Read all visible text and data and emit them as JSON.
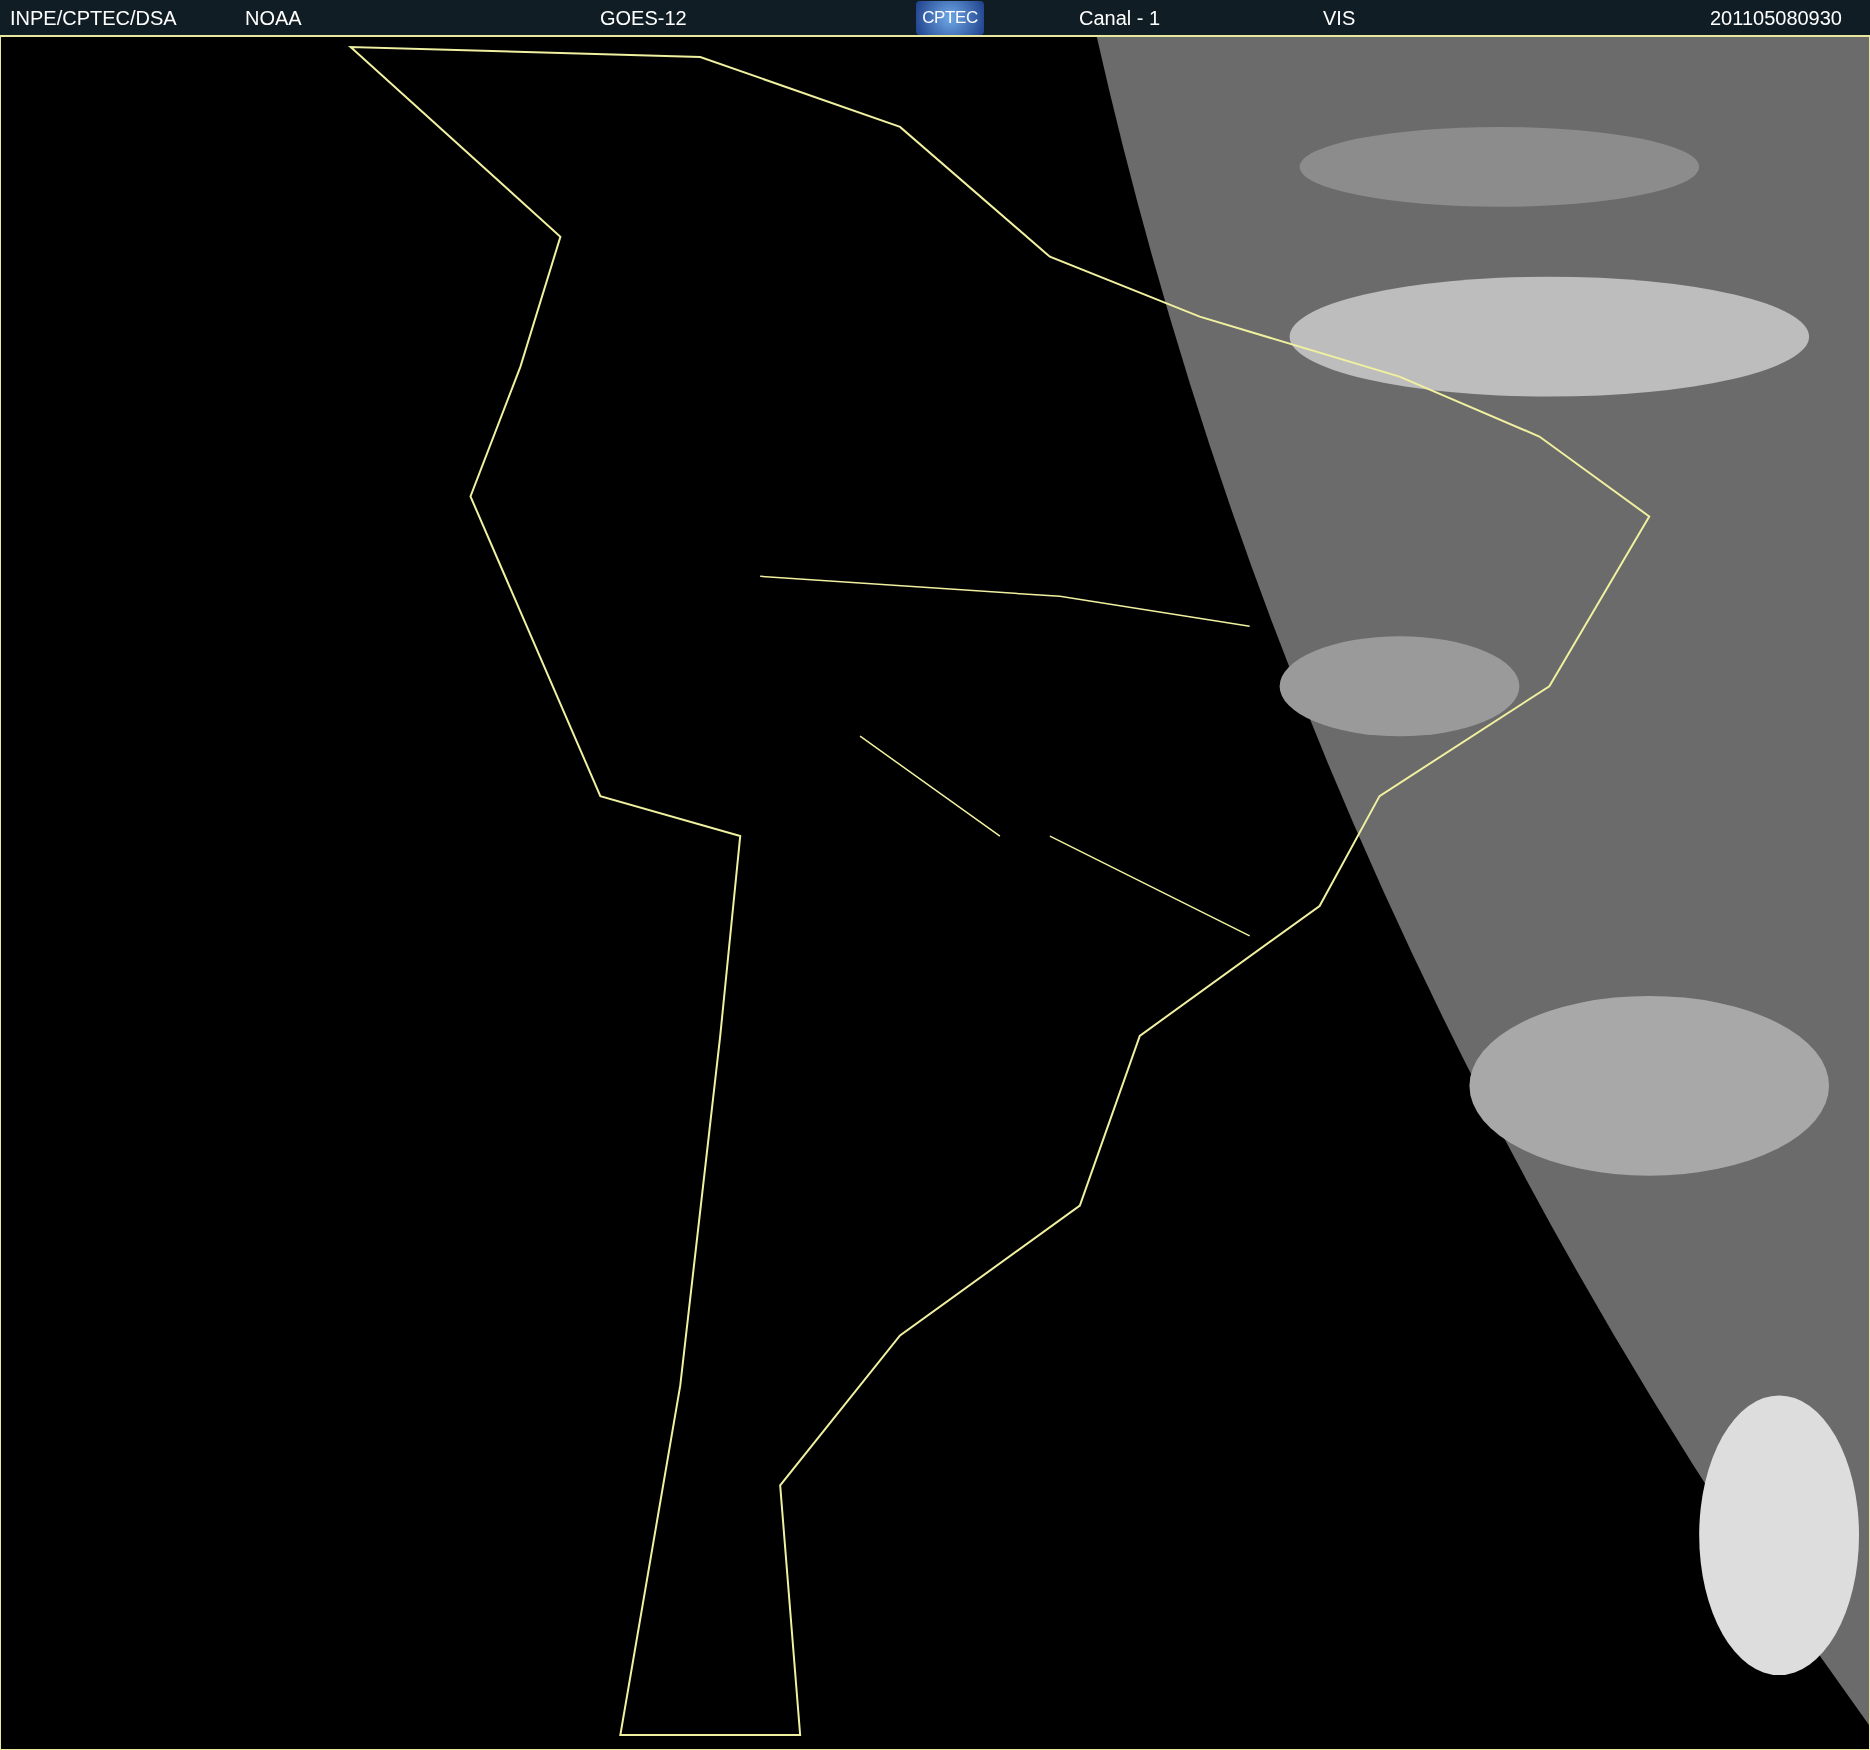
{
  "header": {
    "items": [
      {
        "kind": "text",
        "text": "INPE/CPTEC/DSA"
      },
      {
        "kind": "text",
        "text": "NOAA"
      },
      {
        "kind": "text",
        "text": "GOES-12"
      },
      {
        "kind": "logo",
        "text": "CPTEC"
      },
      {
        "kind": "text",
        "text": "Canal - 1"
      },
      {
        "kind": "text",
        "text": "VIS"
      },
      {
        "kind": "text",
        "text": "201105080930"
      }
    ]
  }
}
